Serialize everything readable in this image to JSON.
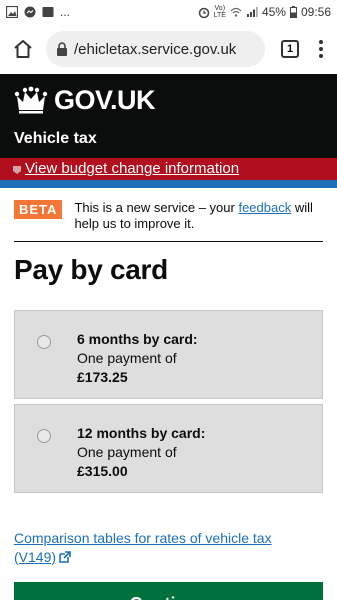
{
  "status_bar": {
    "dots": "...",
    "volte_top": "Vo)",
    "volte_bottom": "LTE",
    "battery": "45%",
    "time": "09:56"
  },
  "browser": {
    "url": "/ehicletax.service.gov.uk",
    "tab_count": "1"
  },
  "header": {
    "logo_text": "GOV.UK",
    "service_name": "Vehicle tax"
  },
  "budget_banner": {
    "link_text": "View budget change information"
  },
  "phase_banner": {
    "tag": "BETA",
    "text_before": "This is a new service – your ",
    "link_text": "feedback",
    "text_after": " will help us to improve it."
  },
  "page_title": "Pay by card",
  "options": [
    {
      "title": "6 months by card:",
      "line2": "One payment of",
      "amount": "£173.25",
      "selected": false
    },
    {
      "title": "12 months by card:",
      "line2": "One payment of",
      "amount": "£315.00",
      "selected": false
    }
  ],
  "comparison_link": "Comparison tables for rates of vehicle tax (V149)",
  "continue_label": "Continue",
  "colors": {
    "gov_black": "#0b0c0c",
    "banner_red": "#b10e1e",
    "link_blue": "#1d70b8",
    "beta_orange": "#f47738",
    "button_green": "#00703c"
  }
}
